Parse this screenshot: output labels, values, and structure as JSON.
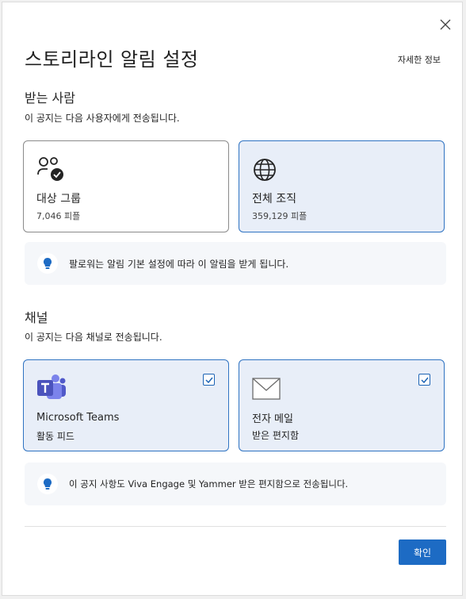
{
  "dialog": {
    "title": "스토리라인 알림 설정",
    "learn_more": "자세한 정보",
    "ok_label": "확인"
  },
  "recipients": {
    "heading": "받는 사람",
    "subtitle": "이 공지는 다음 사용자에게 전송됩니다.",
    "options": [
      {
        "label": "대상 그룹",
        "count": "7,046 피플",
        "selected": false
      },
      {
        "label": "전체 조직",
        "count": "359,129 피플",
        "selected": true
      }
    ],
    "info": "팔로워는 알림 기본 설정에 따라 이 알림을 받게 됩니다."
  },
  "channels": {
    "heading": "채널",
    "subtitle": "이 공지는 다음 채널로 전송됩니다.",
    "options": [
      {
        "label": "Microsoft Teams",
        "detail": "활동 피드",
        "checked": true
      },
      {
        "label": "전자 메일",
        "detail": "받은 편지함",
        "checked": true
      }
    ],
    "info": "이 공지 사항도 Viva Engage 및 Yammer 받은 편지함으로 전송됩니다."
  },
  "colors": {
    "accent": "#1d6bc4",
    "selected_bg": "#e8eef8",
    "selected_border": "#2f73c2"
  }
}
